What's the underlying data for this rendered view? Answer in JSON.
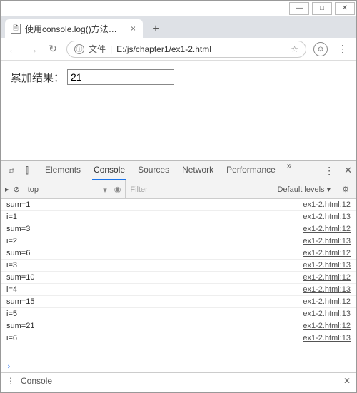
{
  "window": {
    "min": "—",
    "max": "□",
    "close": "✕"
  },
  "tab": {
    "fav": "🗎",
    "title": "使用console.log()方法调试代码",
    "close": "×",
    "new": "+"
  },
  "nav": {
    "back": "←",
    "fwd": "→",
    "reload": "↻",
    "info": "ⓘ",
    "scheme": "文件",
    "url": "E:/js/chapter1/ex1-2.html",
    "star": "☆",
    "user": "☺",
    "menu": "⋮"
  },
  "page": {
    "label": "累加结果：",
    "value": "21"
  },
  "dt": {
    "ico1": "⧉",
    "ico2": "⫿",
    "tabs": [
      "Elements",
      "Console",
      "Sources",
      "Network",
      "Performance"
    ],
    "active": 1,
    "more": "»",
    "menu": "⋮",
    "close": "✕"
  },
  "cn": {
    "play": "▸",
    "clear": "⊘",
    "context": "top",
    "eye": "◉",
    "filter": "Filter",
    "levels": "Default levels ▾",
    "gear": "⚙"
  },
  "logs": [
    {
      "msg": "sum=1",
      "src": "ex1-2.html:12"
    },
    {
      "msg": "i=1",
      "src": "ex1-2.html:13"
    },
    {
      "msg": "sum=3",
      "src": "ex1-2.html:12"
    },
    {
      "msg": "i=2",
      "src": "ex1-2.html:13"
    },
    {
      "msg": "sum=6",
      "src": "ex1-2.html:12"
    },
    {
      "msg": "i=3",
      "src": "ex1-2.html:13"
    },
    {
      "msg": "sum=10",
      "src": "ex1-2.html:12"
    },
    {
      "msg": "i=4",
      "src": "ex1-2.html:13"
    },
    {
      "msg": "sum=15",
      "src": "ex1-2.html:12"
    },
    {
      "msg": "i=5",
      "src": "ex1-2.html:13"
    },
    {
      "msg": "sum=21",
      "src": "ex1-2.html:12"
    },
    {
      "msg": "i=6",
      "src": "ex1-2.html:13"
    }
  ],
  "prompt": "›",
  "drawer": {
    "menu": "⋮",
    "label": "Console",
    "close": "✕"
  }
}
